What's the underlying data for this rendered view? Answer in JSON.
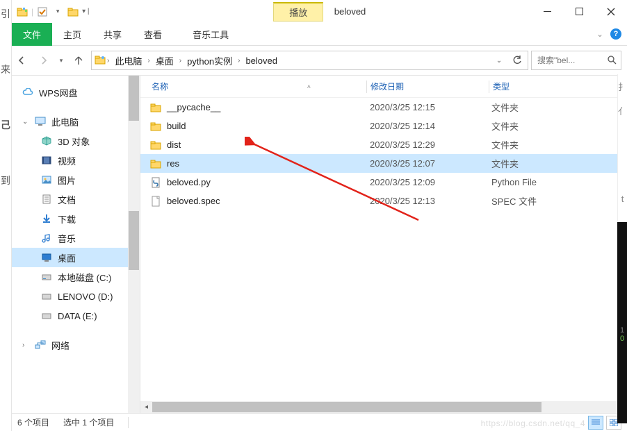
{
  "title": "beloved",
  "context_tab": "播放",
  "ribbon": {
    "file": "文件",
    "home": "主页",
    "share": "共享",
    "view": "查看",
    "music": "音乐工具"
  },
  "breadcrumbs": [
    "此电脑",
    "桌面",
    "python实例",
    "beloved"
  ],
  "search": {
    "placeholder": "搜索\"bel..."
  },
  "sidebar": {
    "wps": "WPS网盘",
    "thispc": "此电脑",
    "items": [
      {
        "label": "3D 对象"
      },
      {
        "label": "视频"
      },
      {
        "label": "图片"
      },
      {
        "label": "文档"
      },
      {
        "label": "下载"
      },
      {
        "label": "音乐"
      },
      {
        "label": "桌面"
      },
      {
        "label": "本地磁盘 (C:)"
      },
      {
        "label": "LENOVO (D:)"
      },
      {
        "label": "DATA (E:)"
      }
    ],
    "network": "网络"
  },
  "columns": {
    "name": "名称",
    "date": "修改日期",
    "type": "类型"
  },
  "files": [
    {
      "name": "__pycache__",
      "date": "2020/3/25 12:15",
      "type": "文件夹",
      "icon": "folder"
    },
    {
      "name": "build",
      "date": "2020/3/25 12:14",
      "type": "文件夹",
      "icon": "folder"
    },
    {
      "name": "dist",
      "date": "2020/3/25 12:29",
      "type": "文件夹",
      "icon": "folder"
    },
    {
      "name": "res",
      "date": "2020/3/25 12:07",
      "type": "文件夹",
      "icon": "folder",
      "selected": true
    },
    {
      "name": "beloved.py",
      "date": "2020/3/25 12:09",
      "type": "Python File",
      "icon": "py"
    },
    {
      "name": "beloved.spec",
      "date": "2020/3/25 12:13",
      "type": "SPEC 文件",
      "icon": "file"
    }
  ],
  "status": {
    "count": "6 个项目",
    "selected": "选中 1 个项目"
  },
  "watermark": "https://blog.csdn.net/qq_4"
}
